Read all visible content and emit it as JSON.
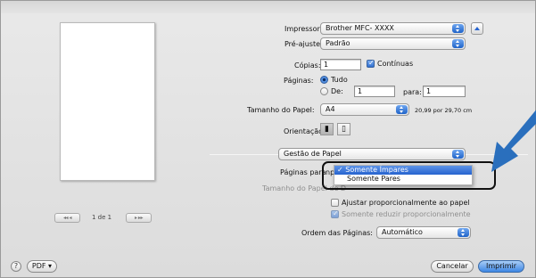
{
  "navigation": {
    "page_counter": "1 de 1",
    "first_prev": "◂◂ ◂",
    "next_last": "▸ ▸▸"
  },
  "printer": {
    "label": "Impressora:",
    "value": "Brother MFC- XXXX"
  },
  "presets": {
    "label": "Pré-ajustes:",
    "value": "Padrão"
  },
  "copies": {
    "label": "Cópias:",
    "value": "1",
    "collated_label": "Contínuas"
  },
  "pages": {
    "label": "Páginas:",
    "all_label": "Tudo",
    "from_label": "De:",
    "from_value": "1",
    "to_label": "para:",
    "to_value": "1"
  },
  "paper_size": {
    "label": "Tamanho do Papel:",
    "value": "A4",
    "dimensions": "20,99 por 29,70 cm"
  },
  "orientation": {
    "label": "Orientação:"
  },
  "section_popup": {
    "value": "Gestão de Papel"
  },
  "pages_to_print": {
    "label": "Páginas para",
    "partial_value": "nprimi",
    "menu_items": [
      "Somente Ímpares",
      "Somente Pares"
    ],
    "selected": "Somente Ímpares"
  },
  "destination_paper": {
    "label": "Tamanho do Papel de D"
  },
  "scale_to_fit": {
    "label": "Ajustar proporcionalmente ao papel"
  },
  "scale_down_only": {
    "label": "Somente reduzir proporcionalmente"
  },
  "page_order": {
    "label": "Ordem das Páginas:",
    "value": "Automático"
  },
  "footer": {
    "help": "?",
    "pdf_label": "PDF ▾",
    "cancel_label": "Cancelar",
    "print_label": "Imprimir"
  },
  "colors": {
    "accent": "#2663cf",
    "callout_arrow": "#2a6fbd"
  }
}
